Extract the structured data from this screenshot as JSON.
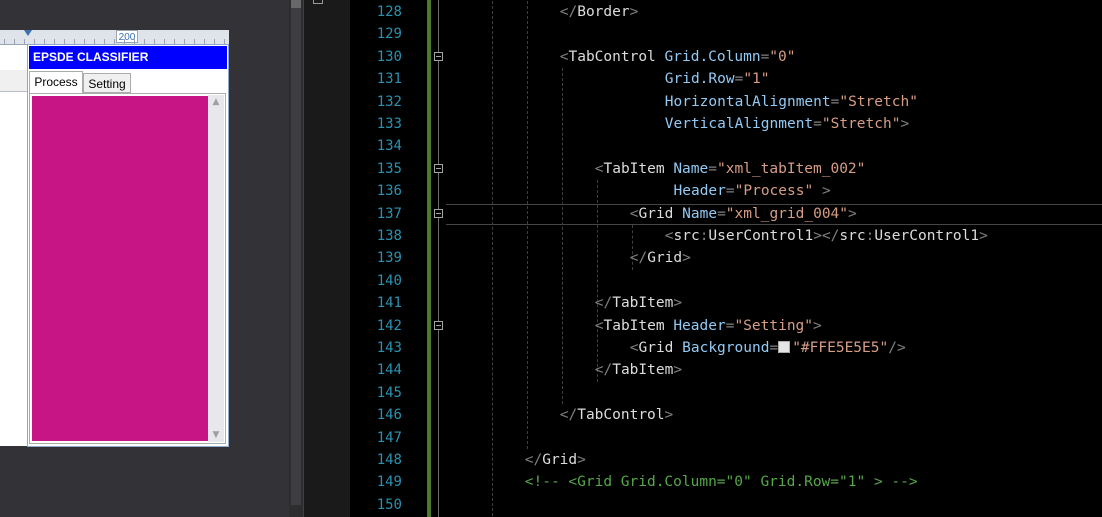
{
  "designer": {
    "ruler_value": "200",
    "window_title": "EPSDE CLASSIFIER",
    "tabs": [
      {
        "label": "Process"
      },
      {
        "label": "Setting"
      }
    ],
    "panel_color": "#c71585",
    "scroll_up_icon": "chevron-up-icon",
    "scroll_down_icon": "chevron-down-icon"
  },
  "editor": {
    "line_numbers": [
      "128",
      "129",
      "130",
      "131",
      "132",
      "133",
      "134",
      "135",
      "136",
      "137",
      "138",
      "139",
      "140",
      "141",
      "142",
      "143",
      "144",
      "145",
      "146",
      "147",
      "148",
      "149",
      "150"
    ],
    "lines": [
      {
        "indent": 13,
        "text": "</Border>"
      },
      {
        "indent": 0,
        "text": ""
      },
      {
        "indent": 13,
        "text": "<TabControl Grid.Column=\"0\""
      },
      {
        "indent": 25,
        "text": "Grid.Row=\"1\""
      },
      {
        "indent": 25,
        "text": "HorizontalAlignment=\"Stretch\""
      },
      {
        "indent": 25,
        "text": "VerticalAlignment=\"Stretch\">"
      },
      {
        "indent": 0,
        "text": ""
      },
      {
        "indent": 17,
        "text": "<TabItem Name=\"xml_tabItem_002\""
      },
      {
        "indent": 26,
        "text": "Header=\"Process\" >"
      },
      {
        "indent": 21,
        "text": "<Grid Name=\"xml_grid_004\">"
      },
      {
        "indent": 25,
        "text": "<src:UserControl1></src:UserControl1>"
      },
      {
        "indent": 21,
        "text": "</Grid>"
      },
      {
        "indent": 0,
        "text": ""
      },
      {
        "indent": 17,
        "text": "</TabItem>"
      },
      {
        "indent": 17,
        "text": "<TabItem Header=\"Setting\">"
      },
      {
        "indent": 21,
        "text": "<Grid Background=\"#FFE5E5E5\"/>"
      },
      {
        "indent": 17,
        "text": "</TabItem>"
      },
      {
        "indent": 0,
        "text": ""
      },
      {
        "indent": 13,
        "text": "</TabControl>"
      },
      {
        "indent": 0,
        "text": ""
      },
      {
        "indent": 9,
        "text": "</Grid>"
      },
      {
        "indent": 9,
        "text": "<!-- <Grid Grid.Column=\"0\" Grid.Row=\"1\" > -->"
      },
      {
        "indent": 0,
        "text": ""
      }
    ],
    "folds_at_lines": [
      130,
      135,
      137,
      142
    ],
    "current_line": 137,
    "colors": {
      "line_number": "#2b91af",
      "attribute": "#92caf4",
      "string": "#d69d85",
      "comment": "#57a64a",
      "change_bar": "#4a7a2a"
    }
  }
}
